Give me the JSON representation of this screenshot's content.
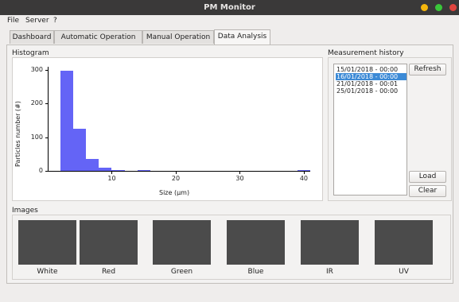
{
  "window": {
    "title": "PM Monitor"
  },
  "menu": [
    "File",
    "Server",
    "?"
  ],
  "tabs": [
    "Dashboard",
    "Automatic Operation",
    "Manual Operation",
    "Data Analysis"
  ],
  "histogram": {
    "label": "Histogram",
    "chart_data": {
      "type": "bar",
      "xlabel": "Size (μm)",
      "ylabel": "Particles number (#)",
      "x_ticks": [
        "10",
        "20",
        "30",
        "40"
      ],
      "y_ticks": [
        "0",
        "100",
        "200",
        "300"
      ],
      "xlim": [
        0,
        41
      ],
      "ylim": [
        0,
        310
      ],
      "bins": [
        {
          "x0": 2,
          "x1": 4,
          "y": 298
        },
        {
          "x0": 4,
          "x1": 6,
          "y": 125
        },
        {
          "x0": 6,
          "x1": 8,
          "y": 35
        },
        {
          "x0": 8,
          "x1": 10,
          "y": 10
        },
        {
          "x0": 10,
          "x1": 12,
          "y": 3
        },
        {
          "x0": 14,
          "x1": 16,
          "y": 2
        },
        {
          "x0": 24,
          "x1": 26,
          "y": 1
        },
        {
          "x0": 29,
          "x1": 31,
          "y": 1
        },
        {
          "x0": 35,
          "x1": 37,
          "y": 1
        },
        {
          "x0": 39,
          "x1": 41,
          "y": 2
        }
      ],
      "color": "#6464f6"
    }
  },
  "measurement_history": {
    "label": "Measurement history",
    "items": [
      "15/01/2018 - 00:00",
      "16/01/2018 - 00:00",
      "21/01/2018 - 00:01",
      "25/01/2018 - 00:00"
    ],
    "selected_index": 1,
    "buttons": {
      "refresh": "Refresh",
      "load": "Load",
      "clear": "Clear"
    }
  },
  "images": {
    "label": "Images",
    "items": [
      "White",
      "Red",
      "Green",
      "Blue",
      "IR",
      "UV"
    ]
  },
  "colors": {
    "titlebar": "#3a3939",
    "close": "#e0443e",
    "maximize": "#3ac73a",
    "minimize": "#f5b60c",
    "selection": "#3c8ad6"
  }
}
